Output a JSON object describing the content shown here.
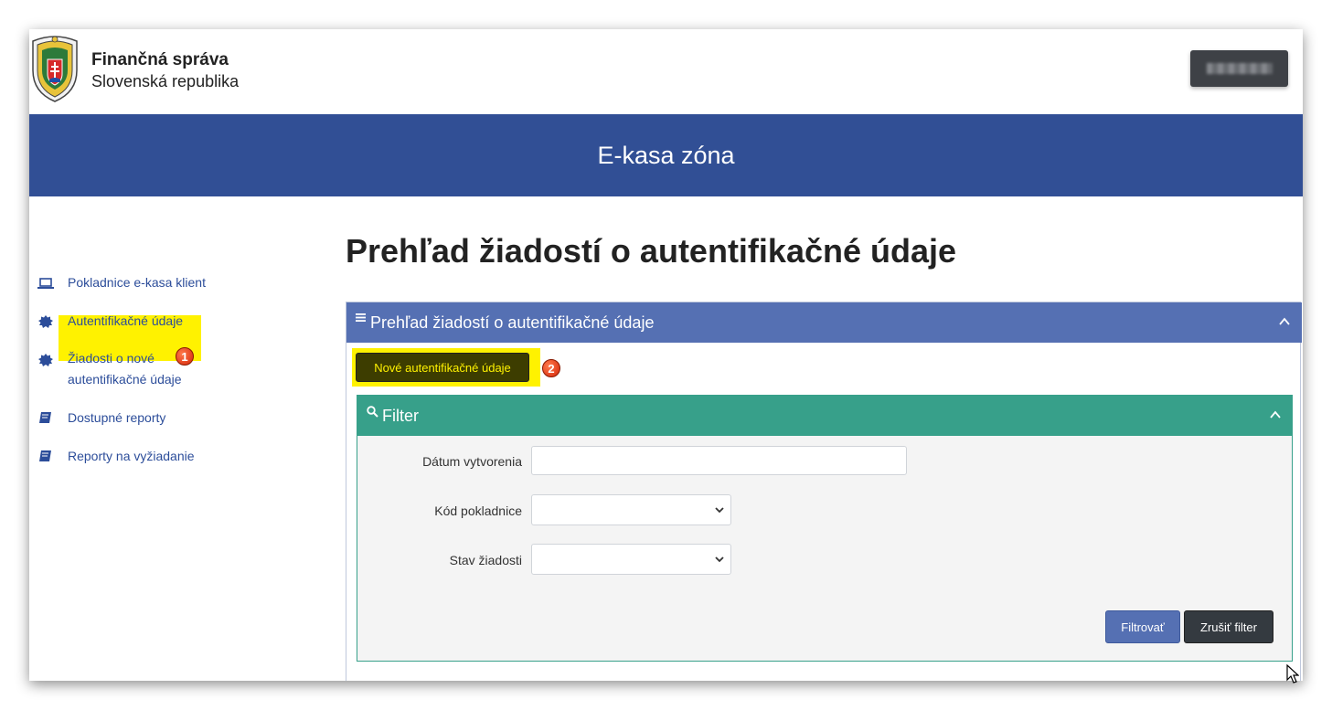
{
  "header": {
    "org_name": "Finančná správa",
    "org_subtitle": "Slovenská republika",
    "user_button_label": ""
  },
  "banner": {
    "title": "E-kasa zóna"
  },
  "sidebar": {
    "items": [
      {
        "label": "Pokladnice e-kasa klient",
        "icon": "laptop-icon"
      },
      {
        "label": "Autentifikačné údaje",
        "icon": "badge-icon"
      },
      {
        "label_line1": "Žiadosti o nové",
        "label_line2": "autentifikačné údaje",
        "icon": "badge-icon",
        "highlighted": true
      },
      {
        "label": "Dostupné reporty",
        "icon": "book-icon"
      },
      {
        "label": "Reporty na vyžiadanie",
        "icon": "book-icon"
      }
    ]
  },
  "main": {
    "page_title": "Prehľad žiadostí o autentifikačné údaje",
    "panel_title": "Prehľad žiadostí o autentifikačné údaje",
    "new_button_label": "Nové autentifikačné údaje",
    "filter": {
      "title": "Filter",
      "fields": [
        {
          "label": "Dátum vytvorenia",
          "value": ""
        },
        {
          "label": "Kód pokladnice",
          "value": ""
        },
        {
          "label": "Stav žiadosti",
          "value": ""
        }
      ],
      "apply_label": "Filtrovať",
      "reset_label": "Zrušiť filter"
    }
  },
  "annotations": {
    "step1": "1",
    "step2": "2"
  },
  "colors": {
    "banner": "#314f95",
    "panel_header": "#5570b3",
    "filter_header": "#37a08a",
    "highlight": "#fff200",
    "link": "#2c4d9a"
  }
}
